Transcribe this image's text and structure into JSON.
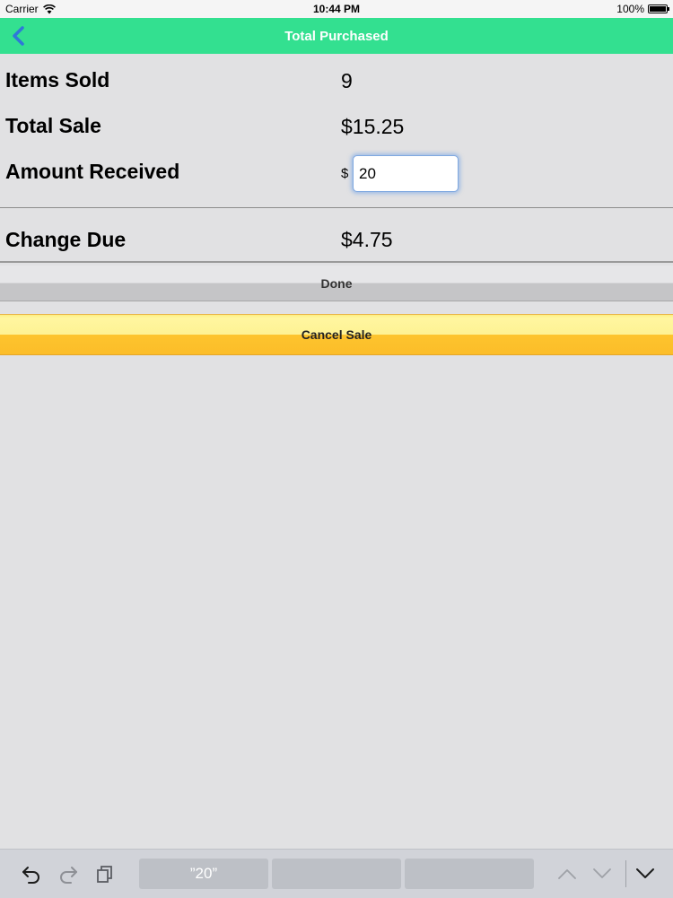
{
  "status_bar": {
    "carrier": "Carrier",
    "time": "10:44 PM",
    "battery": "100%"
  },
  "nav": {
    "title": "Total Purchased",
    "back_icon": "chevron-left-icon",
    "color": "#33e090"
  },
  "summary": {
    "items_sold_label": "Items Sold",
    "items_sold_value": "9",
    "total_sale_label": "Total Sale",
    "total_sale_value": "$15.25",
    "amount_received_label": "Amount Received",
    "currency_symbol": "$",
    "amount_received_value": "20",
    "change_due_label": "Change Due",
    "change_due_value": "$4.75"
  },
  "actions": {
    "done_label": "Done",
    "cancel_label": "Cancel Sale",
    "cancel_color": "#fdc42e"
  },
  "keyboard_bar": {
    "undo_icon": "undo-icon",
    "redo_icon": "redo-icon",
    "paste_icon": "clipboard-icon",
    "suggestions": [
      "”20”",
      "",
      ""
    ],
    "prev_icon": "chevron-up-icon",
    "next_icon": "chevron-down-icon",
    "dismiss_icon": "keyboard-dismiss-icon"
  }
}
